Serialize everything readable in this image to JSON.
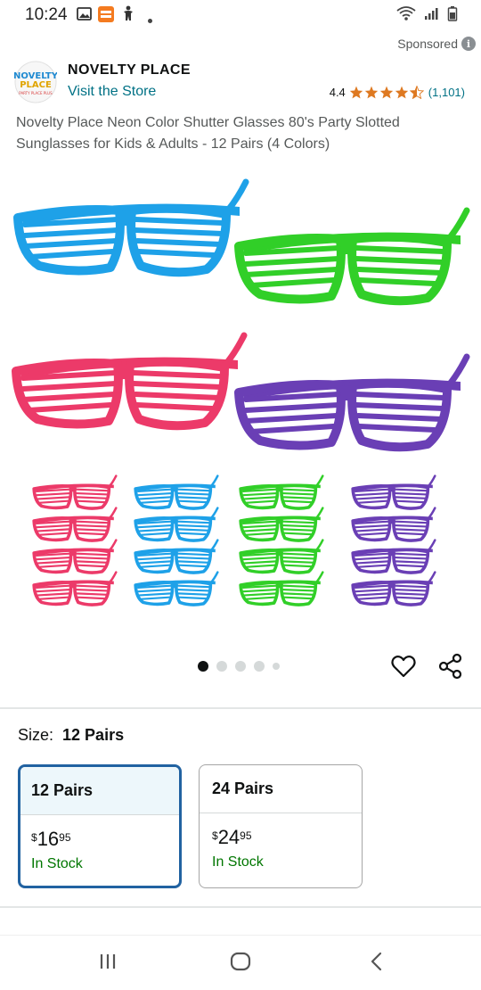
{
  "status_bar": {
    "time": "10:24",
    "icons_left": [
      "gallery-icon",
      "app-notification-icon",
      "accessibility-icon",
      "dot-icon"
    ],
    "icons_right": [
      "wifi-icon",
      "signal-icon",
      "battery-icon"
    ]
  },
  "ad": {
    "sponsored_label": "Sponsored",
    "info_icon": "info-icon"
  },
  "brand": {
    "logo_text": "NOVELTY PLACE",
    "name": "NOVELTY PLACE",
    "visit_store": "Visit the Store",
    "rating_value": "4.4",
    "stars": 4.5,
    "rating_count": "(1,101)"
  },
  "product": {
    "title": "Novelty Place Neon Color Shutter Glasses 80's Party Slotted Sunglasses for Kids & Adults - 12 Pairs (4 Colors)",
    "colors": {
      "blue": "#1ea1e8",
      "green": "#31cf28",
      "pink": "#ec3a69",
      "purple": "#6a3fb5"
    }
  },
  "carousel": {
    "count": 5,
    "active_index": 0,
    "favorite_icon": "heart-icon",
    "share_icon": "share-icon"
  },
  "size_selector": {
    "label": "Size:",
    "selected": "12 Pairs",
    "options": [
      {
        "name": "12 Pairs",
        "currency": "$",
        "price_whole": "16",
        "price_fraction": "95",
        "stock": "In Stock",
        "selected": true
      },
      {
        "name": "24 Pairs",
        "currency": "$",
        "price_whole": "24",
        "price_fraction": "95",
        "stock": "In Stock",
        "selected": false
      }
    ]
  },
  "nav_bar": {
    "buttons": [
      "recent-apps-icon",
      "home-icon",
      "back-icon"
    ]
  },
  "theme": {
    "link": "#007185",
    "star": "#de7921",
    "stock": "#007600",
    "selected_border": "#2162a1",
    "selected_bg": "#edf7fb"
  }
}
